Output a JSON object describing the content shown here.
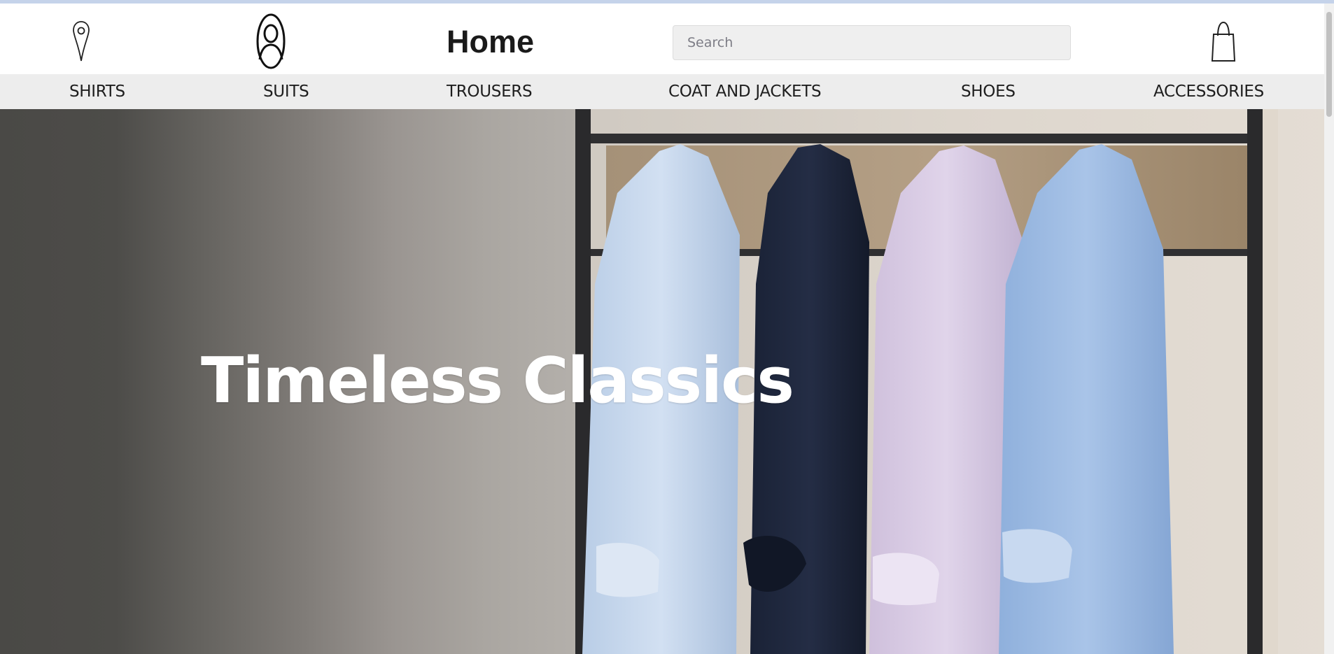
{
  "header": {
    "title": "Home",
    "location_icon": "location-pin-icon",
    "account_icon": "user-account-icon",
    "cart_icon": "shopping-bag-icon"
  },
  "search": {
    "placeholder": "Search",
    "value": ""
  },
  "nav": {
    "items": [
      {
        "label": "SHIRTS"
      },
      {
        "label": "SUITS"
      },
      {
        "label": "TROUSERS"
      },
      {
        "label": "COAT AND JACKETS"
      },
      {
        "label": "SHOES"
      },
      {
        "label": "ACCESSORIES"
      }
    ]
  },
  "hero": {
    "title": "Timeless Classics",
    "image_icon": "hanging-shirts-photo"
  },
  "colors": {
    "nav_background": "#ededed",
    "search_background": "#efefef",
    "title_text": "#1a1a1a",
    "hero_text": "#ffffff"
  }
}
